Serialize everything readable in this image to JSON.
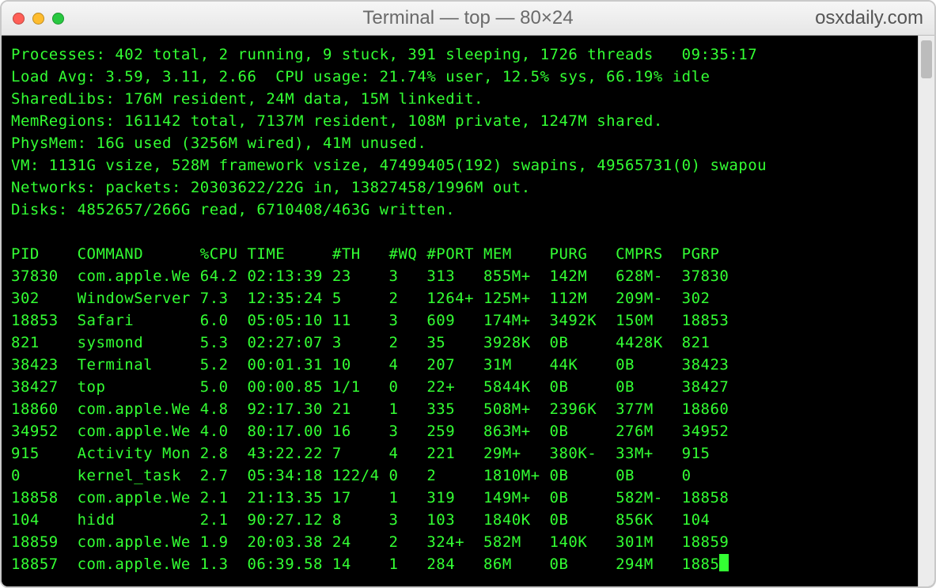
{
  "window": {
    "title": "Terminal — top — 80×24",
    "watermark": "osxdaily.com"
  },
  "header": {
    "processes": "Processes: 402 total, 2 running, 9 stuck, 391 sleeping, 1726 threads   09:35:17",
    "loadavg": "Load Avg: 3.59, 3.11, 2.66  CPU usage: 21.74% user, 12.5% sys, 66.19% idle",
    "sharedlibs": "SharedLibs: 176M resident, 24M data, 15M linkedit.",
    "memregions": "MemRegions: 161142 total, 7137M resident, 108M private, 1247M shared.",
    "physmem": "PhysMem: 16G used (3256M wired), 41M unused.",
    "vm": "VM: 1131G vsize, 528M framework vsize, 47499405(192) swapins, 49565731(0) swapou",
    "networks": "Networks: packets: 20303622/22G in, 13827458/1996M out.",
    "disks": "Disks: 4852657/266G read, 6710408/463G written."
  },
  "columns": [
    "PID",
    "COMMAND",
    "%CPU",
    "TIME",
    "#TH",
    "#WQ",
    "#PORT",
    "MEM",
    "PURG",
    "CMPRS",
    "PGRP"
  ],
  "rows": [
    {
      "pid": "37830",
      "command": "com.apple.We",
      "cpu": "64.2",
      "time": "02:13:39",
      "th": "23",
      "wq": "3",
      "port": "313",
      "mem": "855M+",
      "purg": "142M",
      "cmprs": "628M-",
      "pgrp": "37830"
    },
    {
      "pid": "302",
      "command": "WindowServer",
      "cpu": "7.3",
      "time": "12:35:24",
      "th": "5",
      "wq": "2",
      "port": "1264+",
      "mem": "125M+",
      "purg": "112M",
      "cmprs": "209M-",
      "pgrp": "302"
    },
    {
      "pid": "18853",
      "command": "Safari",
      "cpu": "6.0",
      "time": "05:05:10",
      "th": "11",
      "wq": "3",
      "port": "609",
      "mem": "174M+",
      "purg": "3492K",
      "cmprs": "150M",
      "pgrp": "18853"
    },
    {
      "pid": "821",
      "command": "sysmond",
      "cpu": "5.3",
      "time": "02:27:07",
      "th": "3",
      "wq": "2",
      "port": "35",
      "mem": "3928K",
      "purg": "0B",
      "cmprs": "4428K",
      "pgrp": "821"
    },
    {
      "pid": "38423",
      "command": "Terminal",
      "cpu": "5.2",
      "time": "00:01.31",
      "th": "10",
      "wq": "4",
      "port": "207",
      "mem": "31M",
      "purg": "44K",
      "cmprs": "0B",
      "pgrp": "38423"
    },
    {
      "pid": "38427",
      "command": "top",
      "cpu": "5.0",
      "time": "00:00.85",
      "th": "1/1",
      "wq": "0",
      "port": "22+",
      "mem": "5844K",
      "purg": "0B",
      "cmprs": "0B",
      "pgrp": "38427"
    },
    {
      "pid": "18860",
      "command": "com.apple.We",
      "cpu": "4.8",
      "time": "92:17.30",
      "th": "21",
      "wq": "1",
      "port": "335",
      "mem": "508M+",
      "purg": "2396K",
      "cmprs": "377M",
      "pgrp": "18860"
    },
    {
      "pid": "34952",
      "command": "com.apple.We",
      "cpu": "4.0",
      "time": "80:17.00",
      "th": "16",
      "wq": "3",
      "port": "259",
      "mem": "863M+",
      "purg": "0B",
      "cmprs": "276M",
      "pgrp": "34952"
    },
    {
      "pid": "915",
      "command": "Activity Mon",
      "cpu": "2.8",
      "time": "43:22.22",
      "th": "7",
      "wq": "4",
      "port": "221",
      "mem": "29M+",
      "purg": "380K-",
      "cmprs": "33M+",
      "pgrp": "915"
    },
    {
      "pid": "0",
      "command": "kernel_task",
      "cpu": "2.7",
      "time": "05:34:18",
      "th": "122/4",
      "wq": "0",
      "port": "2",
      "mem": "1810M+",
      "purg": "0B",
      "cmprs": "0B",
      "pgrp": "0"
    },
    {
      "pid": "18858",
      "command": "com.apple.We",
      "cpu": "2.1",
      "time": "21:13.35",
      "th": "17",
      "wq": "1",
      "port": "319",
      "mem": "149M+",
      "purg": "0B",
      "cmprs": "582M-",
      "pgrp": "18858"
    },
    {
      "pid": "104",
      "command": "hidd",
      "cpu": "2.1",
      "time": "90:27.12",
      "th": "8",
      "wq": "3",
      "port": "103",
      "mem": "1840K",
      "purg": "0B",
      "cmprs": "856K",
      "pgrp": "104"
    },
    {
      "pid": "18859",
      "command": "com.apple.We",
      "cpu": "1.9",
      "time": "20:03.38",
      "th": "24",
      "wq": "2",
      "port": "324+",
      "mem": "582M",
      "purg": "140K",
      "cmprs": "301M",
      "pgrp": "18859"
    },
    {
      "pid": "18857",
      "command": "com.apple.We",
      "cpu": "1.3",
      "time": "06:39.58",
      "th": "14",
      "wq": "1",
      "port": "284",
      "mem": "86M",
      "purg": "0B",
      "cmprs": "294M",
      "pgrp": "1885"
    }
  ]
}
